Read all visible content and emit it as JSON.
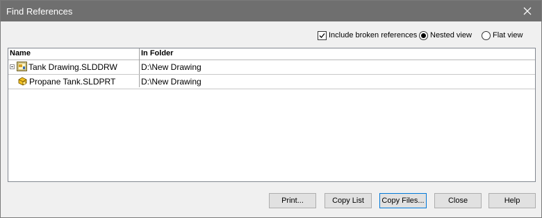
{
  "window": {
    "title": "Find References"
  },
  "options": {
    "include_broken_label": "Include broken references",
    "include_broken_checked": true,
    "nested_label": "Nested view",
    "nested_selected": true,
    "flat_label": "Flat view",
    "flat_selected": false
  },
  "table": {
    "columns": [
      "Name",
      "In Folder"
    ],
    "rows": [
      {
        "name": "Tank Drawing.SLDDRW",
        "folder": "D:\\New Drawing",
        "icon": "drawing-icon",
        "expanded": true
      },
      {
        "name": "Propane Tank.SLDPRT",
        "folder": "D:\\New Drawing",
        "icon": "part-icon"
      }
    ]
  },
  "buttons": {
    "print": "Print...",
    "copy_list": "Copy List",
    "copy_files": "Copy Files...",
    "close": "Close",
    "help": "Help"
  },
  "colors": {
    "titlebar": "#6f6f6f",
    "focus_border": "#0078d7"
  }
}
